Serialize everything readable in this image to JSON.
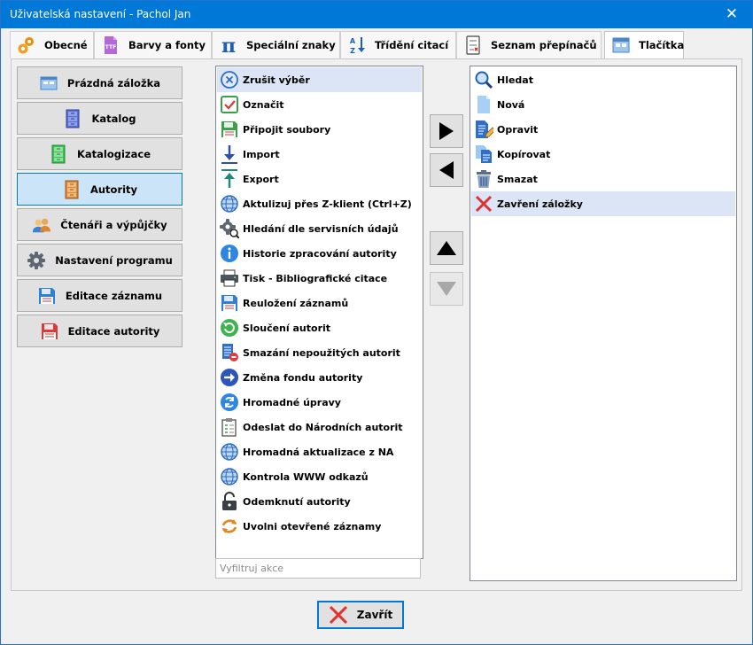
{
  "window": {
    "title": "Uživatelská nastavení - Pachol Jan",
    "close_glyph": "✕"
  },
  "tabs": [
    {
      "label": "Obecné",
      "icon": "gears-icon"
    },
    {
      "label": "Barvy a fonty",
      "icon": "ttf-font-icon"
    },
    {
      "label": "Speciální znaky",
      "icon": "pi-icon"
    },
    {
      "label": "Třídění citací",
      "icon": "sort-az-icon"
    },
    {
      "label": "Seznam přepínačů",
      "icon": "checklist-icon"
    },
    {
      "label": "Tlačítka",
      "icon": "window-icon",
      "active": true
    }
  ],
  "categories": [
    {
      "label": "Prázdná záložka",
      "icon": "window-icon"
    },
    {
      "label": "Katalog",
      "icon": "cabinet-blue-icon"
    },
    {
      "label": "Katalogizace",
      "icon": "cabinet-green-icon"
    },
    {
      "label": "Autority",
      "icon": "cabinet-orange-icon",
      "active": true
    },
    {
      "label": "Čtenáři a výpůjčky",
      "icon": "users-icon"
    },
    {
      "label": "Nastavení programu",
      "icon": "gear-icon"
    },
    {
      "label": "Editace záznamu",
      "icon": "floppy-blue-icon"
    },
    {
      "label": "Editace autority",
      "icon": "floppy-red-icon"
    }
  ],
  "available_actions": [
    {
      "label": "Zrušit výběr",
      "icon": "cancel-circle-icon",
      "selected": true
    },
    {
      "label": "Označit",
      "icon": "checkbox-icon"
    },
    {
      "label": "Připojit soubory",
      "icon": "floppy-attach-icon"
    },
    {
      "label": "Import",
      "icon": "import-icon"
    },
    {
      "label": "Export",
      "icon": "export-icon"
    },
    {
      "label": "Aktulizuj přes Z-klient (Ctrl+Z)",
      "icon": "globe-icon"
    },
    {
      "label": "Hledání dle servisních údajů",
      "icon": "gear-search-icon"
    },
    {
      "label": "Historie zpracování autority",
      "icon": "info-icon"
    },
    {
      "label": "Tisk - Bibliografické citace",
      "icon": "printer-icon"
    },
    {
      "label": "Reuložení záznamů",
      "icon": "floppy-blue-icon"
    },
    {
      "label": "Sloučení autorit",
      "icon": "merge-icon"
    },
    {
      "label": "Smazání nepoužitých autorit",
      "icon": "delete-doc-icon"
    },
    {
      "label": "Změna fondu autority",
      "icon": "arrow-right-circle-icon"
    },
    {
      "label": "Hromadné úpravy",
      "icon": "bulk-edit-icon"
    },
    {
      "label": "Odeslat do Národních autorit",
      "icon": "clipboard-icon"
    },
    {
      "label": "Hromadná aktualizace z NA",
      "icon": "globe-icon"
    },
    {
      "label": "Kontrola WWW odkazů",
      "icon": "globe-icon"
    },
    {
      "label": "Odemknutí autority",
      "icon": "unlock-icon"
    },
    {
      "label": "Uvolni otevřené záznamy",
      "icon": "refresh-icon"
    }
  ],
  "selected_actions": [
    {
      "label": "Hledat",
      "icon": "search-icon"
    },
    {
      "label": "Nová",
      "icon": "new-doc-icon"
    },
    {
      "label": "Opravit",
      "icon": "edit-doc-icon"
    },
    {
      "label": "Kopírovat",
      "icon": "copy-icon"
    },
    {
      "label": "Smazat",
      "icon": "trash-icon"
    },
    {
      "label": "Zavření záložky",
      "icon": "close-x-icon",
      "selected": true
    }
  ],
  "filter": {
    "placeholder": "Vyfiltruj akce",
    "value": ""
  },
  "footer": {
    "close_label": "Zavřít",
    "icon": "close-x-icon"
  },
  "colors": {
    "titlebar": "#0078d7",
    "selection": "#dbe5f5",
    "active_button": "#cce4f7"
  }
}
